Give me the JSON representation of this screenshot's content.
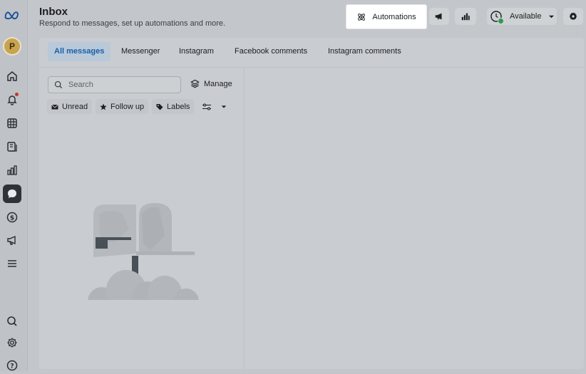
{
  "header": {
    "title": "Inbox",
    "subtitle": "Respond to messages, set up automations and more."
  },
  "toolbar": {
    "automations_label": "Automations",
    "status_label": "Available"
  },
  "sidebar": {
    "avatar_initial": "P"
  },
  "tabs": [
    {
      "label": "All messages"
    },
    {
      "label": "Messenger"
    },
    {
      "label": "Instagram"
    },
    {
      "label": "Facebook comments"
    },
    {
      "label": "Instagram comments"
    }
  ],
  "search": {
    "placeholder": "Search"
  },
  "manage_label": "Manage",
  "filters": [
    {
      "label": "Unread"
    },
    {
      "label": "Follow up"
    },
    {
      "label": "Labels"
    }
  ],
  "colors": {
    "active_tab": "#1a5fa8",
    "status_online": "#2e9b4e",
    "notification": "#c0392b"
  }
}
